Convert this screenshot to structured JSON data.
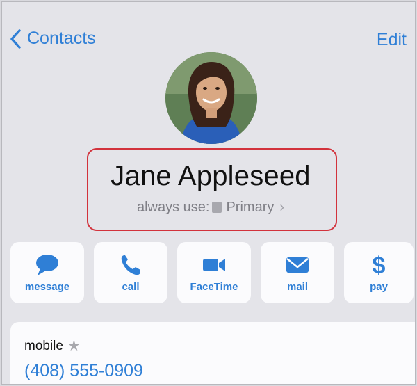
{
  "nav": {
    "back_label": "Contacts",
    "edit_label": "Edit"
  },
  "contact": {
    "name": "Jane Appleseed",
    "always_use_prefix": "always use:",
    "always_use_value": "Primary"
  },
  "actions": [
    {
      "label": "message",
      "icon": "message-bubble-icon"
    },
    {
      "label": "call",
      "icon": "phone-icon"
    },
    {
      "label": "FaceTime",
      "icon": "video-camera-icon"
    },
    {
      "label": "mail",
      "icon": "envelope-icon"
    },
    {
      "label": "pay",
      "icon": "dollar-icon"
    }
  ],
  "phone_card": {
    "label": "mobile",
    "number": "(408) 555-0909"
  },
  "colors": {
    "accent": "#2f7fd6",
    "highlight": "#d2323c",
    "background": "#e4e4e9"
  }
}
